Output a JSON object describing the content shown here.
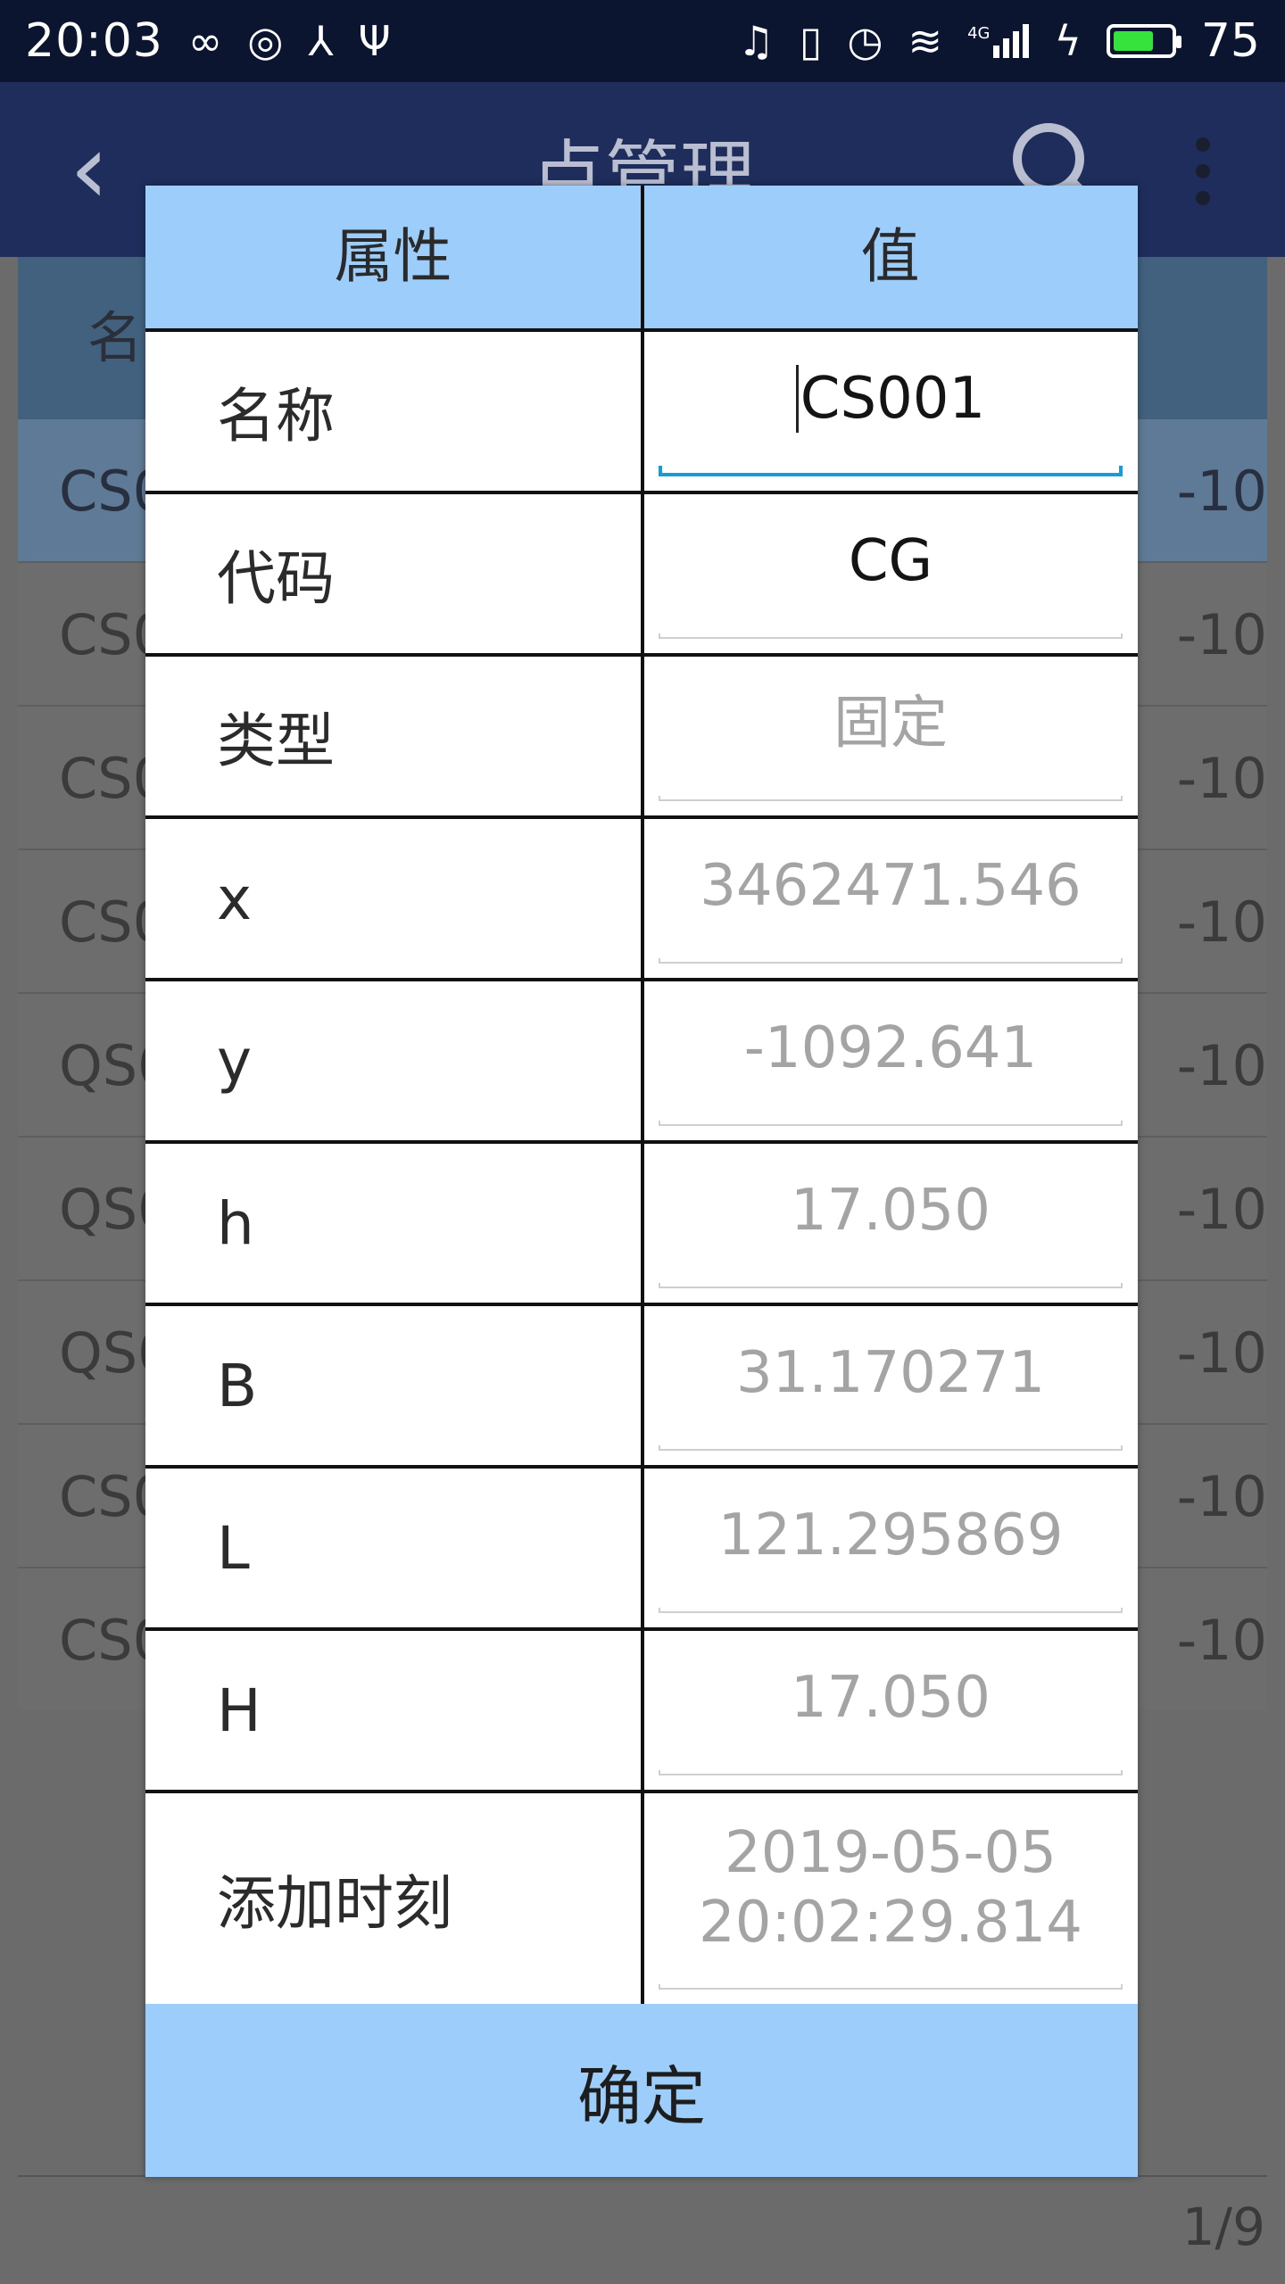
{
  "status_bar": {
    "time": "20:03",
    "left_icons": [
      "infinity-icon",
      "netease-music-icon",
      "share-hub-icon",
      "usb-icon"
    ],
    "right_icons": [
      "headset-icon",
      "vibrate-icon",
      "alarm-icon",
      "wifi-icon",
      "signal-4g-icon",
      "charging-icon"
    ],
    "network_label": "4G",
    "battery_level": "75",
    "battery_fraction": 0.75,
    "battery_color": "#36e23c"
  },
  "app_bar": {
    "title": "点管理",
    "back_icon": "back-arrow-icon",
    "search_icon": "search-icon",
    "more_icon": "more-vert-icon",
    "color": "#1f2d5c"
  },
  "background_table": {
    "header_first_col": "名",
    "rows": [
      {
        "c1": "CS0",
        "c2": "-10",
        "selected": true
      },
      {
        "c1": "CS0",
        "c2": "-10"
      },
      {
        "c1": "CS0",
        "c2": "-10"
      },
      {
        "c1": "CS0",
        "c2": "-10"
      },
      {
        "c1": "QS0",
        "c2": "-10"
      },
      {
        "c1": "QS0",
        "c2": "-10"
      },
      {
        "c1": "QS0",
        "c2": "-10"
      },
      {
        "c1": "CS0",
        "c2": "-10"
      },
      {
        "c1": "CS0",
        "c2": "-10"
      }
    ],
    "pager": "1/9"
  },
  "dialog": {
    "col_attr": "属性",
    "col_value": "值",
    "header_color": "#9dcefb",
    "rows": [
      {
        "label": "名称",
        "value": "CS001",
        "editable": true,
        "focused": true
      },
      {
        "label": "代码",
        "value": "CG",
        "editable": true
      },
      {
        "label": "类型",
        "value": "固定",
        "editable": false
      },
      {
        "label": "x",
        "value": "3462471.546",
        "editable": false
      },
      {
        "label": "y",
        "value": "-1092.641",
        "editable": false
      },
      {
        "label": "h",
        "value": "17.050",
        "editable": false
      },
      {
        "label": "B",
        "value": "31.170271",
        "editable": false
      },
      {
        "label": "L",
        "value": "121.295869",
        "editable": false
      },
      {
        "label": "H",
        "value": "17.050",
        "editable": false
      },
      {
        "label": "添加时刻",
        "value_line1": "2019-05-05",
        "value_line2": "20:02:29.814",
        "editable": false
      }
    ],
    "ok_label": "确定"
  }
}
